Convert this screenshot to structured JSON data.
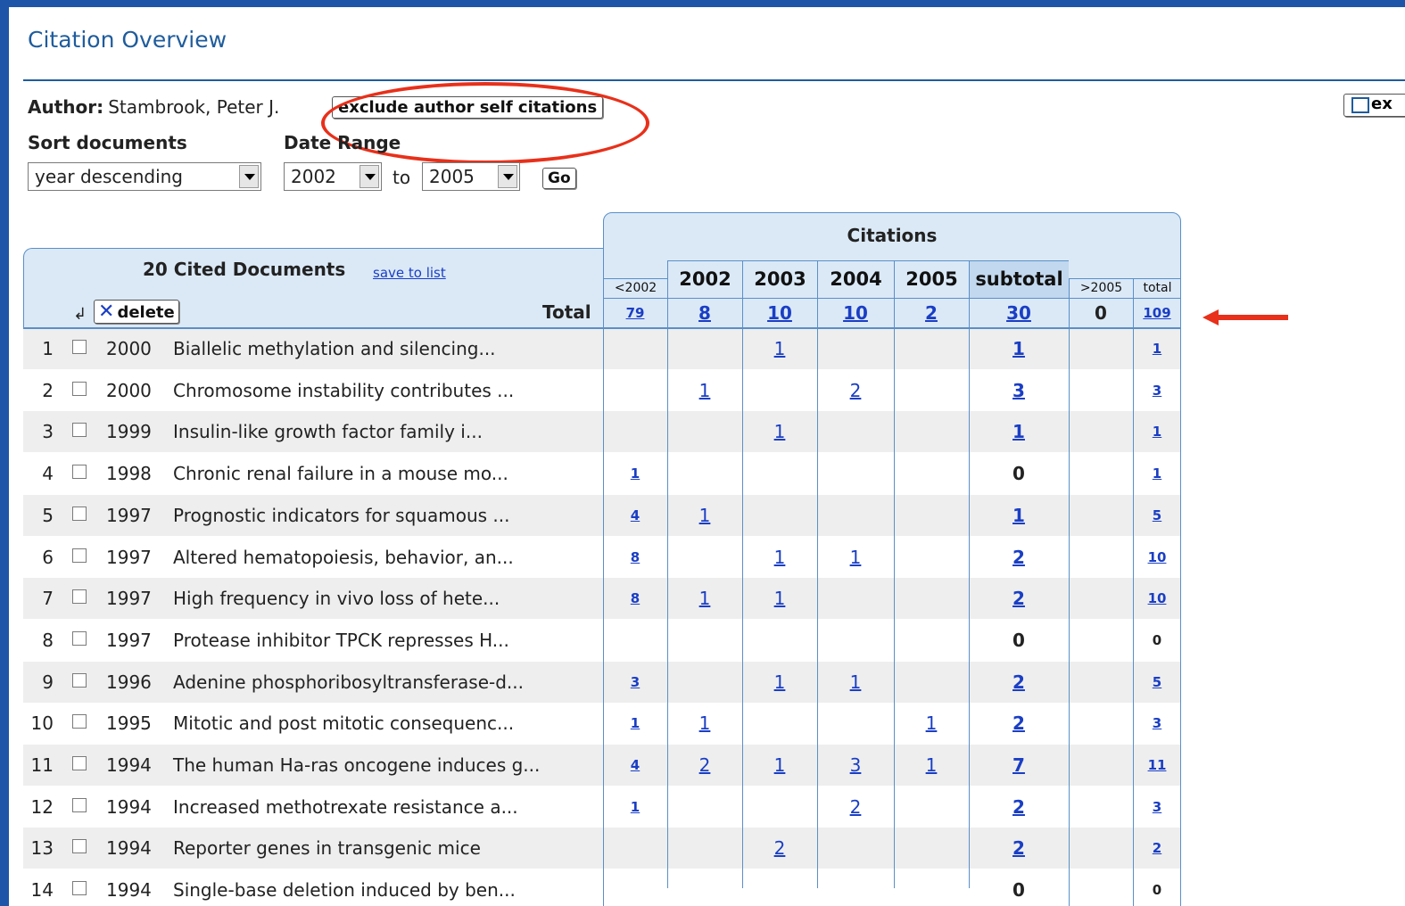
{
  "page_title": "Citation Overview",
  "author": {
    "label": "Author:",
    "name": "Stambrook, Peter J."
  },
  "exclude_button": "exclude author self citations",
  "export_button": "ex",
  "sort": {
    "label": "Sort documents",
    "value": "year descending"
  },
  "date_range": {
    "label": "Date Range",
    "from": "2002",
    "to_label": "to",
    "to": "2005"
  },
  "go_button": "Go",
  "docs": {
    "title": "20 Cited Documents",
    "save_link": "save to list",
    "delete_label": "delete",
    "total_label": "Total"
  },
  "citations": {
    "title": "Citations",
    "columns": [
      "<2002",
      "2002",
      "2003",
      "2004",
      "2005",
      "subtotal",
      ">2005",
      "total"
    ],
    "totals": [
      "79",
      "8",
      "10",
      "10",
      "2",
      "30",
      "0",
      "109"
    ]
  },
  "rows": [
    {
      "n": "1",
      "year": "2000",
      "title": "Biallelic methylation and silencing...",
      "c": [
        "",
        "",
        "1",
        "",
        "",
        "1",
        "",
        "1"
      ]
    },
    {
      "n": "2",
      "year": "2000",
      "title": "Chromosome instability contributes ...",
      "c": [
        "",
        "1",
        "",
        "2",
        "",
        "3",
        "",
        "3"
      ]
    },
    {
      "n": "3",
      "year": "1999",
      "title": "Insulin-like growth factor family i...",
      "c": [
        "",
        "",
        "1",
        "",
        "",
        "1",
        "",
        "1"
      ]
    },
    {
      "n": "4",
      "year": "1998",
      "title": "Chronic renal failure in a mouse mo...",
      "c": [
        "1",
        "",
        "",
        "",
        "",
        "0",
        "",
        "1"
      ]
    },
    {
      "n": "5",
      "year": "1997",
      "title": "Prognostic indicators for squamous ...",
      "c": [
        "4",
        "1",
        "",
        "",
        "",
        "1",
        "",
        "5"
      ]
    },
    {
      "n": "6",
      "year": "1997",
      "title": "Altered hematopoiesis, behavior, an...",
      "c": [
        "8",
        "",
        "1",
        "1",
        "",
        "2",
        "",
        "10"
      ]
    },
    {
      "n": "7",
      "year": "1997",
      "title": "High frequency in vivo loss of hete...",
      "c": [
        "8",
        "1",
        "1",
        "",
        "",
        "2",
        "",
        "10"
      ]
    },
    {
      "n": "8",
      "year": "1997",
      "title": "Protease inhibitor TPCK represses H...",
      "c": [
        "",
        "",
        "",
        "",
        "",
        "0",
        "",
        "0"
      ]
    },
    {
      "n": "9",
      "year": "1996",
      "title": "Adenine phosphoribosyltransferase-d...",
      "c": [
        "3",
        "",
        "1",
        "1",
        "",
        "2",
        "",
        "5"
      ]
    },
    {
      "n": "10",
      "year": "1995",
      "title": "Mitotic and post mitotic consequenc...",
      "c": [
        "1",
        "1",
        "",
        "",
        "1",
        "2",
        "",
        "3"
      ]
    },
    {
      "n": "11",
      "year": "1994",
      "title": "The human Ha-ras oncogene induces g...",
      "c": [
        "4",
        "2",
        "1",
        "3",
        "1",
        "7",
        "",
        "11"
      ]
    },
    {
      "n": "12",
      "year": "1994",
      "title": "Increased methotrexate resistance a...",
      "c": [
        "1",
        "",
        "",
        "2",
        "",
        "2",
        "",
        "3"
      ]
    },
    {
      "n": "13",
      "year": "1994",
      "title": "Reporter genes in transgenic mice",
      "c": [
        "",
        "",
        "2",
        "",
        "",
        "2",
        "",
        "2"
      ]
    },
    {
      "n": "14",
      "year": "1994",
      "title": "Single-base deletion induced by ben...",
      "c": [
        "",
        "",
        "",
        "",
        "",
        "0",
        "",
        "0"
      ]
    }
  ],
  "colors": {
    "accent": "#1f5c9c",
    "link": "#1a3ec4",
    "highlight": "#e8301a",
    "header_bg": "#dbe9f7"
  }
}
